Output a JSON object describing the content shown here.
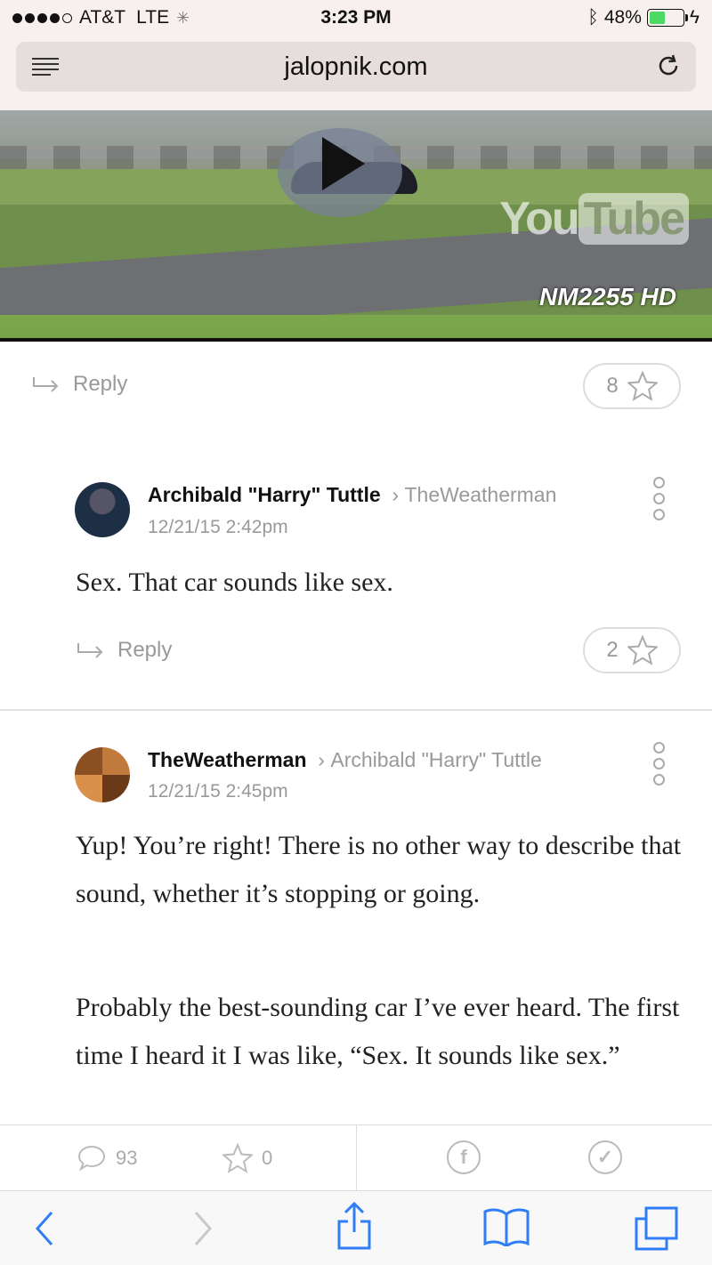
{
  "status_bar": {
    "carrier": "AT&T",
    "network": "LTE",
    "time": "3:23 PM",
    "battery_percent": "48%",
    "battery_level": 0.48
  },
  "url_bar": {
    "url": "jalopnik.com"
  },
  "video": {
    "youtube_logo_you": "You",
    "youtube_logo_tube": "Tube",
    "watermark": "NM2255 HD"
  },
  "top_reply": {
    "reply_label": "Reply",
    "star_count": "8"
  },
  "comments": [
    {
      "author": "Archibald \"Harry\" Tuttle",
      "replying_to": "TheWeatherman",
      "date": "12/21/15 2:42pm",
      "paragraphs": [
        "Sex. That car sounds like sex."
      ],
      "reply_label": "Reply",
      "star_count": "2"
    },
    {
      "author": "TheWeatherman",
      "replying_to": "Archibald \"Harry\" Tuttle",
      "date": "12/21/15 2:45pm",
      "paragraphs": [
        "Yup! You’re right! There is no other way to describe that sound, whether it’s stopping or going.",
        "Probably the best-sounding car I’ve ever heard. The first time I heard it I was like, “Sex. It sounds like sex.”"
      ]
    }
  ],
  "article_footer": {
    "comment_count": "93",
    "star_count": "0"
  },
  "colors": {
    "status_bg": "#f7f0ee",
    "battery_green": "#4cd964",
    "toolbar_blue": "#2f7ef6"
  }
}
